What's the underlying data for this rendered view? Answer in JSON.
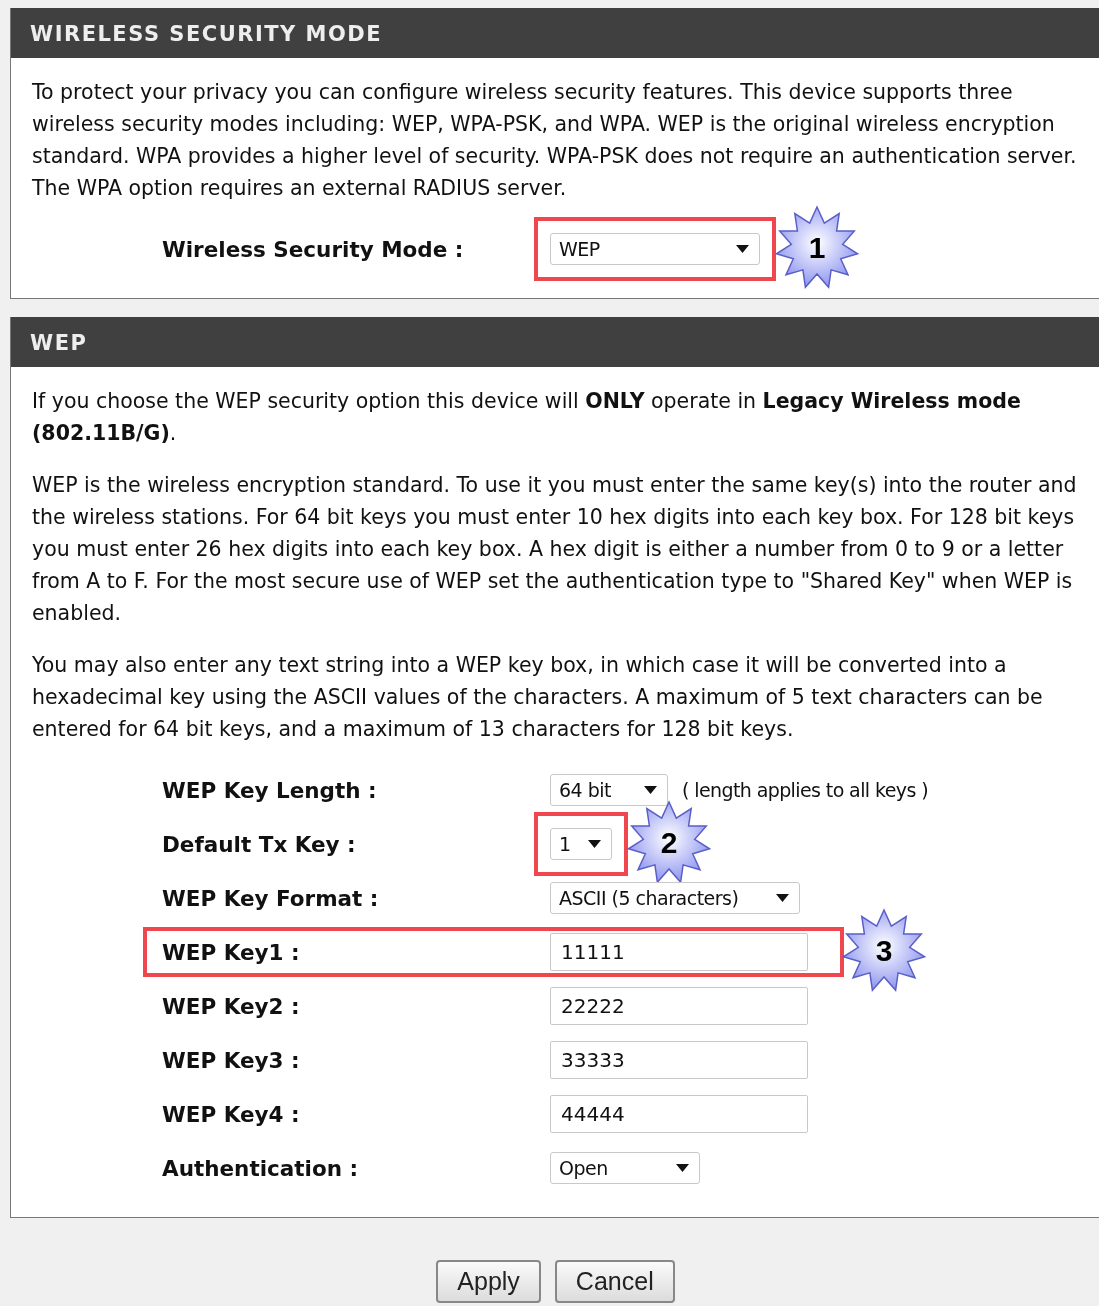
{
  "sections": [
    {
      "title": "WIRELESS SECURITY MODE",
      "paragraphs": [
        "To protect your privacy you can configure wireless security features. This device supports three wireless security modes including: WEP, WPA-PSK, and WPA. WEP is the original wireless encryption standard. WPA provides a higher level of security. WPA-PSK does not require an authentication server. The WPA option requires an external RADIUS server."
      ],
      "fields": [
        {
          "label": "Wireless Security Mode :",
          "kind": "select",
          "value": "WEP",
          "highlighted": true,
          "row_highlighted": false,
          "callout": "1"
        }
      ]
    },
    {
      "title": "WEP",
      "paragraphs": [
        "If you choose the WEP security option this device will **ONLY** operate in **Legacy Wireless mode (802.11B/G)**.",
        "WEP is the wireless encryption standard. To use it you must enter the same key(s) into the router and the wireless stations. For 64 bit keys you must enter 10 hex digits into each key box. For 128 bit keys you must enter 26 hex digits into each key box. A hex digit is either a number from 0 to 9 or a letter from A to F. For the most secure use of WEP set the authentication type to \"Shared Key\" when WEP is enabled.",
        "You may also enter any text string into a WEP key box, in which case it will be converted into a hexadecimal key using the ASCII values of the characters. A maximum of 5 text characters can be entered for 64 bit keys, and a maximum of 13 characters for 128 bit keys."
      ],
      "fields": [
        {
          "label": "WEP Key Length :",
          "kind": "select",
          "value": "64 bit",
          "highlighted": false,
          "row_highlighted": false,
          "note": "( length applies to all keys )"
        },
        {
          "label": "Default Tx Key :",
          "kind": "select",
          "value": "1",
          "highlighted": true,
          "row_highlighted": false,
          "callout": "2"
        },
        {
          "label": "WEP Key Format :",
          "kind": "select",
          "value": "ASCII (5 characters)",
          "highlighted": false,
          "row_highlighted": false
        },
        {
          "label": "WEP Key1 :",
          "kind": "text",
          "value": "11111",
          "highlighted": false,
          "row_highlighted": true,
          "callout": "3"
        },
        {
          "label": "WEP Key2 :",
          "kind": "text",
          "value": "22222",
          "highlighted": false,
          "row_highlighted": false
        },
        {
          "label": "WEP Key3 :",
          "kind": "text",
          "value": "33333",
          "highlighted": false,
          "row_highlighted": false
        },
        {
          "label": "WEP Key4 :",
          "kind": "text",
          "value": "44444",
          "highlighted": false,
          "row_highlighted": false
        },
        {
          "label": "Authentication :",
          "kind": "select",
          "value": "Open",
          "highlighted": false,
          "row_highlighted": false
        }
      ]
    }
  ],
  "buttons": [
    "Apply",
    "Cancel"
  ]
}
